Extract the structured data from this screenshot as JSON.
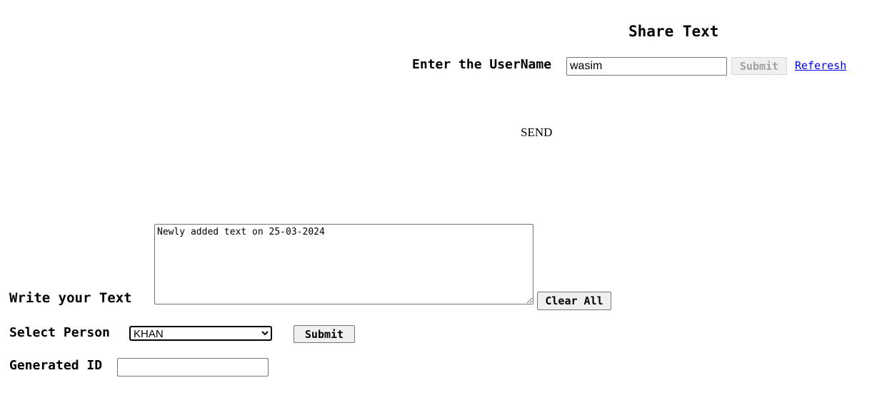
{
  "header": {
    "title": "Share Text"
  },
  "user": {
    "label": "Enter the UserName",
    "value": "wasim",
    "submit_label": "Submit",
    "refresh_label": "Referesh"
  },
  "send": {
    "label": "SEND"
  },
  "compose": {
    "label": "Write your Text",
    "value": "Newly added text on 25-03-2024",
    "clear_label": "Clear All"
  },
  "person": {
    "label": "Select Person",
    "selected": "KHAN",
    "submit_label": "Submit"
  },
  "generated": {
    "label": "Generated ID",
    "value": ""
  }
}
